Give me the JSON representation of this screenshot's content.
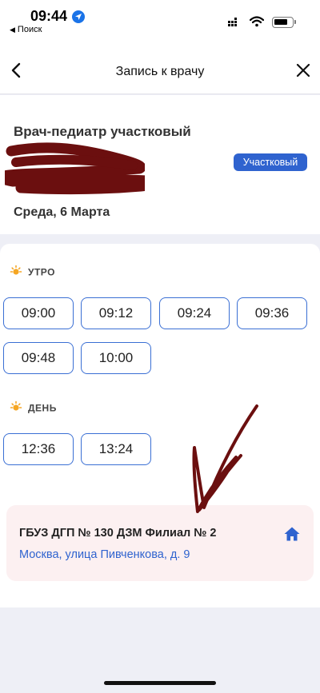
{
  "status_bar": {
    "time": "09:44",
    "back_label": "Поиск",
    "icons": [
      "location-arrow-icon",
      "signal-icon",
      "wifi-icon",
      "battery-icon"
    ]
  },
  "nav": {
    "title": "Запись к врачу",
    "back_icon": "chevron-left-icon",
    "close_icon": "close-icon"
  },
  "doctor": {
    "specialty": "Врач-педиатр участковый",
    "badge": "Участковый",
    "date": "Среда, 6 Марта"
  },
  "periods": [
    {
      "label": "УТРО",
      "icon": "sun-icon",
      "slots": [
        "09:00",
        "09:12",
        "09:24",
        "09:36",
        "09:48",
        "10:00"
      ]
    },
    {
      "label": "ДЕНЬ",
      "icon": "sun-icon",
      "slots": [
        "12:36",
        "13:24"
      ]
    }
  ],
  "clinic": {
    "name": "ГБУЗ ДГП № 130 ДЗМ Филиал № 2",
    "address": "Москва, улица Пивченкова, д. 9",
    "icon": "home-icon"
  },
  "colors": {
    "accent": "#2f63cf",
    "slot_border": "#3a6fd4",
    "page_background": "#eeeff6",
    "clinic_card": "#fcf0f1",
    "sun": "#f5a623",
    "scribble": "#6b0f0f"
  }
}
